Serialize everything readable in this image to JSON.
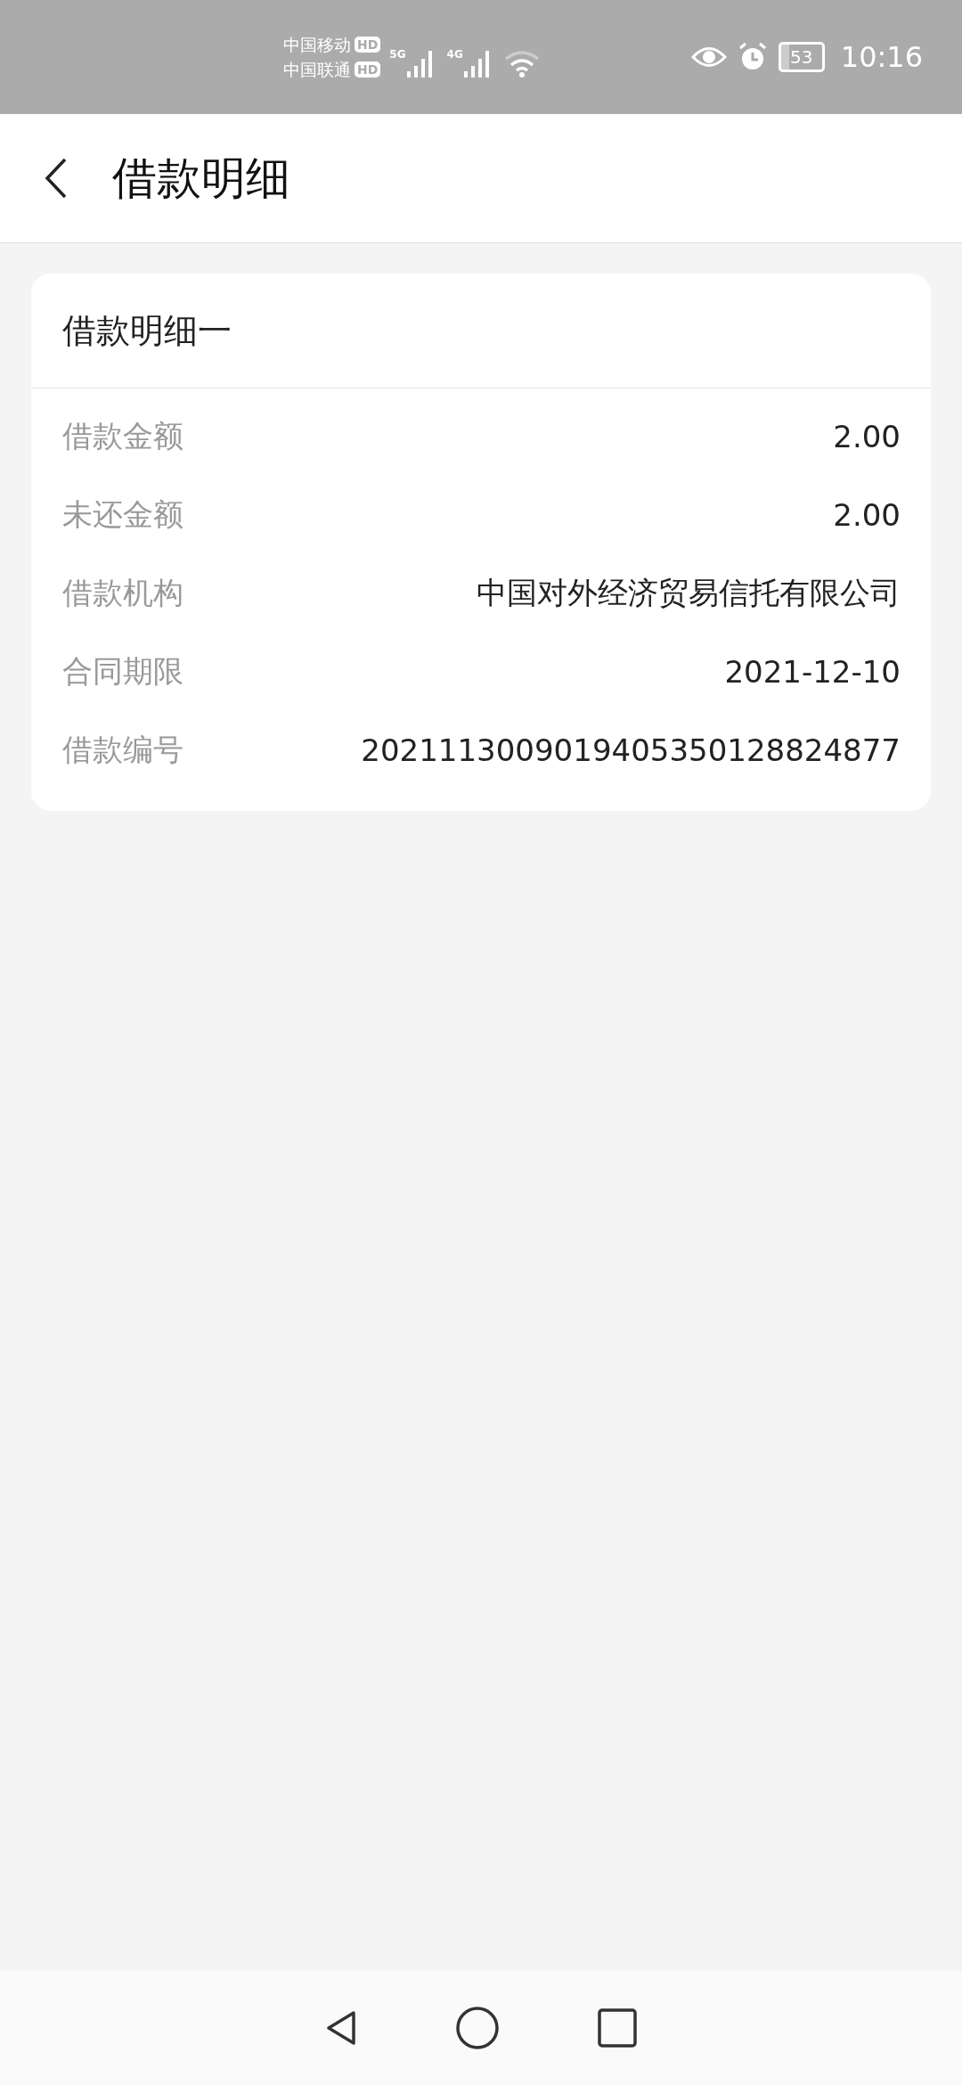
{
  "status_bar": {
    "carriers": [
      {
        "name": "中国移动",
        "badge": "HD"
      },
      {
        "name": "中国联通",
        "badge": "HD"
      }
    ],
    "networks": [
      "5G",
      "4G"
    ],
    "battery": "53",
    "time": "10:16"
  },
  "header": {
    "title": "借款明细"
  },
  "card": {
    "title": "借款明细一",
    "rows": [
      {
        "label": "借款金额",
        "value": "2.00"
      },
      {
        "label": "未还金额",
        "value": "2.00"
      },
      {
        "label": "借款机构",
        "value": "中国对外经济贸易信托有限公司"
      },
      {
        "label": "合同期限",
        "value": "2021-12-10"
      },
      {
        "label": "借款编号",
        "value": "2021113009019405350128824877"
      }
    ]
  }
}
